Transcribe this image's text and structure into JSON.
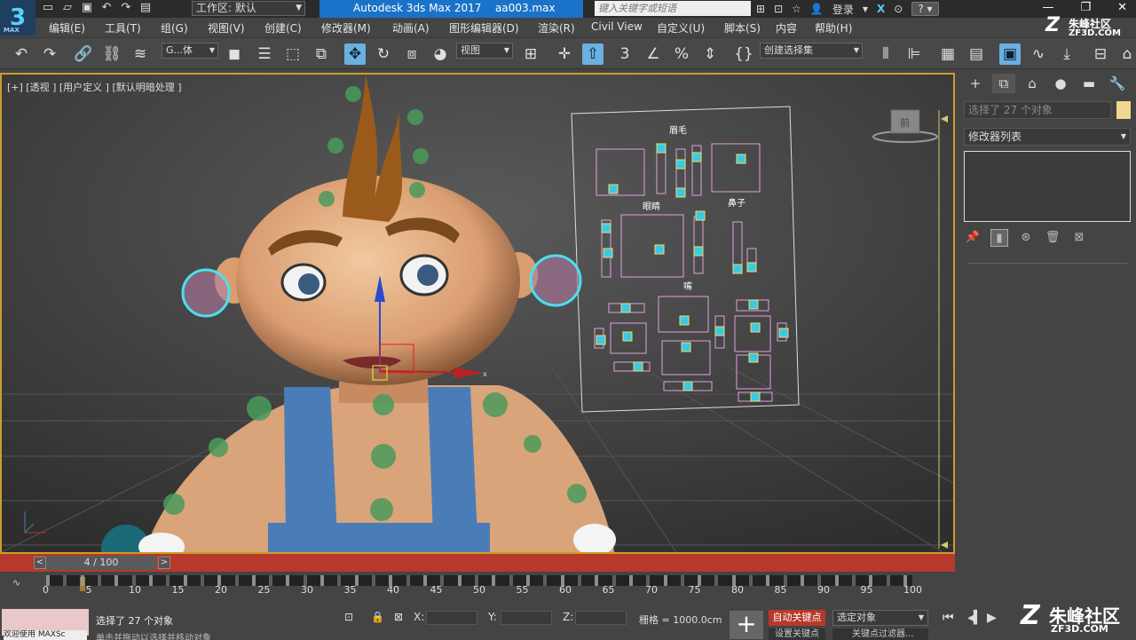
{
  "titlebar": {
    "workspace_label": "工作区: 默认",
    "app_title": "Autodesk 3ds Max 2017",
    "file_name": "aa003.max",
    "search_placeholder": "键入关键字或短语",
    "login_label": "登录",
    "help_label": "?",
    "logo_text": "3",
    "logo_sub": "MAX"
  },
  "menu": {
    "items": [
      "编辑(E)",
      "工具(T)",
      "组(G)",
      "视图(V)",
      "创建(C)",
      "修改器(M)",
      "动画(A)",
      "图形编辑器(D)",
      "渲染(R)",
      "Civil View",
      "自定义(U)",
      "脚本(S)",
      "内容",
      "帮助(H)"
    ]
  },
  "watermark": {
    "name": "朱峰社区",
    "domain": "ZF3D.COM",
    "big_name": "朱峰社区",
    "big_domain": "ZF3D.COM"
  },
  "toolbar": {
    "selection_filter": "G...体",
    "ref_coord": "视图",
    "named_selection": "创建选择集"
  },
  "viewport": {
    "label": "[+] [透视 ] [用户定义 ] [默认明暗处理 ]",
    "uv_labels": {
      "eyebrow": "眉毛",
      "eye": "眼睛",
      "nose": "鼻子",
      "mouth": "嘴"
    },
    "gizmo_z": "z",
    "gizmo_x": "x",
    "viewcube_label": "前"
  },
  "command_panel": {
    "selection_info": "选择了 27 个对象",
    "modifier_list": "修改器列表"
  },
  "timeline": {
    "frame_display": "4 / 100",
    "prev": "<",
    "next": ">",
    "ticks": [
      "0",
      "5",
      "10",
      "15",
      "20",
      "25",
      "30",
      "35",
      "40",
      "45",
      "50",
      "55",
      "60",
      "65",
      "70",
      "75",
      "80",
      "85",
      "90",
      "95",
      "100"
    ]
  },
  "status": {
    "welcome": "欢迎使用 MAXSc",
    "message": "选择了 27 个对象",
    "prompt": "单击并拖动以选择并移动对象",
    "x_label": "X:",
    "y_label": "Y:",
    "z_label": "Z:",
    "grid": "栅格 = 1000.0cm",
    "auto_key": "自动关键点",
    "set_key": "设置关键点",
    "selected_object": "选定对象",
    "key_filter": "关键点过滤器..."
  },
  "colors": {
    "title_accent": "#1a73c8",
    "viewport_border": "#c8a028",
    "auto_key_red": "#b8382c"
  }
}
